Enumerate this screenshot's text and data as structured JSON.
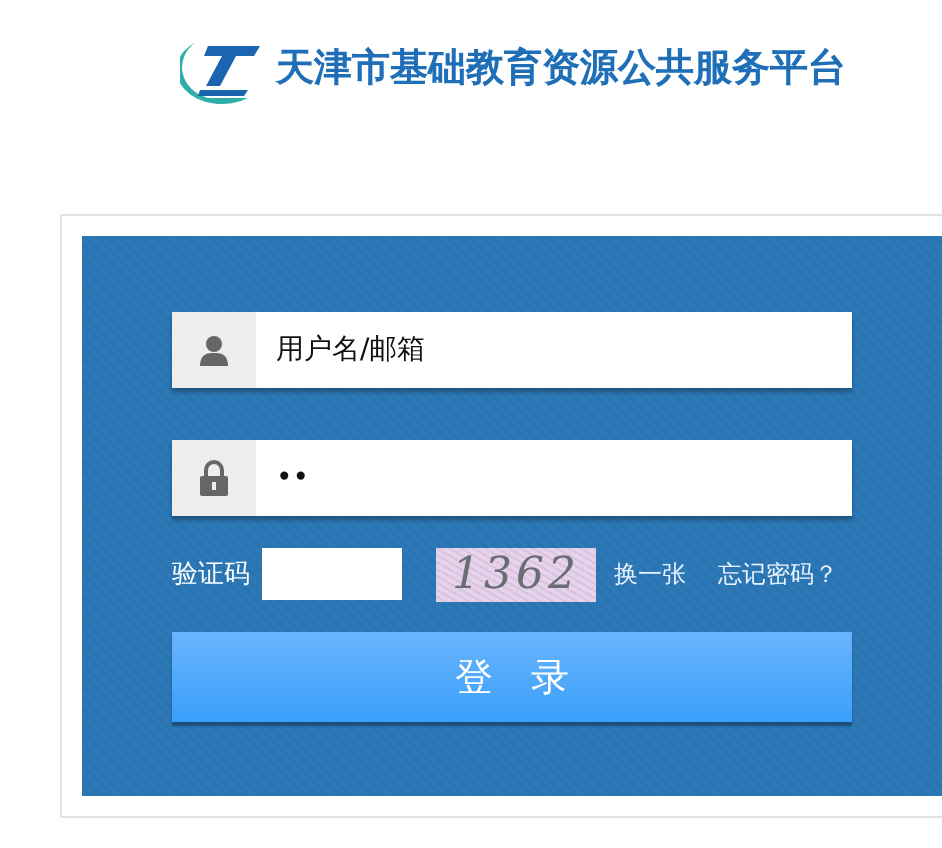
{
  "header": {
    "title": "天津市基础教育资源公共服务平台"
  },
  "form": {
    "username": {
      "value": "用户名/邮箱"
    },
    "password": {
      "value": "••"
    },
    "captcha": {
      "label": "验证码",
      "code": "1362",
      "refresh": "换一张",
      "forgot": "忘记密码？"
    },
    "submit": "登　录"
  }
}
